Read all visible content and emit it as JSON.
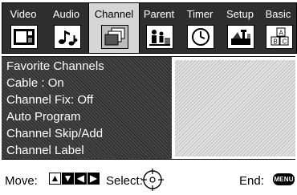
{
  "tabs": [
    {
      "label": "Video",
      "icon": "tv-screen-icon",
      "selected": false
    },
    {
      "label": "Audio",
      "icon": "music-notes-icon",
      "selected": false
    },
    {
      "label": "Channel",
      "icon": "channel-stack-icon",
      "selected": true
    },
    {
      "label": "Parent",
      "icon": "parent-family-icon",
      "selected": false
    },
    {
      "label": "Timer",
      "icon": "clock-icon",
      "selected": false
    },
    {
      "label": "Setup",
      "icon": "setup-tools-icon",
      "selected": false
    },
    {
      "label": "Basic",
      "icon": "abc-blocks-icon",
      "selected": false
    }
  ],
  "menu": {
    "items": [
      {
        "label": "Favorite Channels"
      },
      {
        "label": "Cable : On"
      },
      {
        "label": "Channel Fix: Off"
      },
      {
        "label": "Auto Program"
      },
      {
        "label": "Channel Skip/Add"
      },
      {
        "label": "Channel Label"
      }
    ]
  },
  "help": {
    "move_label": "Move:",
    "select_label": "Select:",
    "end_label": "End:",
    "menu_key_label": "MENU",
    "arrows": [
      "▲",
      "▼",
      "◀",
      "▶"
    ]
  },
  "colors": {
    "tab_bar": "#2e2e2e",
    "tab_selected": "#d6d6d6",
    "menu_bg": "#3a3a3a",
    "text_light": "#ffffff"
  }
}
